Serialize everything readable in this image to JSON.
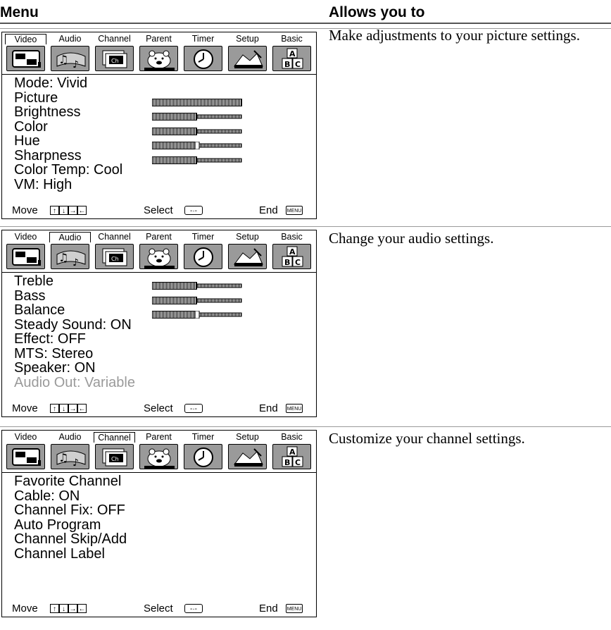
{
  "header": {
    "menu": "Menu",
    "allows": "Allows you to"
  },
  "tabs": [
    "Video",
    "Audio",
    "Channel",
    "Parent",
    "Timer",
    "Setup",
    "Basic"
  ],
  "footer": {
    "move": "Move",
    "select": "Select",
    "end": "End",
    "menu_key": "MENU"
  },
  "sections": [
    {
      "active_tab": "Video",
      "description": "Make adjustments to your picture settings.",
      "items": [
        {
          "text": "Mode:  Vivid"
        },
        {
          "text": "Picture",
          "level": 1.0
        },
        {
          "text": "Brightness",
          "level": 0.5
        },
        {
          "text": "Color",
          "level": 0.5
        },
        {
          "text": "Hue",
          "level": 0.5,
          "center": true
        },
        {
          "text": "Sharpness",
          "level": 0.5
        },
        {
          "text": "Color Temp:  Cool"
        },
        {
          "text": "VM:  High"
        }
      ]
    },
    {
      "active_tab": "Audio",
      "description": "Change your audio settings.",
      "items": [
        {
          "text": "Treble",
          "level": 0.5
        },
        {
          "text": "Bass",
          "level": 0.5
        },
        {
          "text": "Balance",
          "level": 0.5,
          "center": true
        },
        {
          "text": "Steady Sound:  ON"
        },
        {
          "text": "Effect:  OFF"
        },
        {
          "text": "MTS:  Stereo"
        },
        {
          "text": "Speaker:  ON"
        },
        {
          "text": "Audio Out:  Variable",
          "dim": true
        }
      ]
    },
    {
      "active_tab": "Channel",
      "description": "Customize your channel settings.",
      "items": [
        {
          "text": "Favorite Channel"
        },
        {
          "text": "Cable:  ON"
        },
        {
          "text": "Channel Fix:  OFF"
        },
        {
          "text": "Auto Program"
        },
        {
          "text": "Channel Skip/Add"
        },
        {
          "text": "Channel Label"
        }
      ]
    }
  ]
}
